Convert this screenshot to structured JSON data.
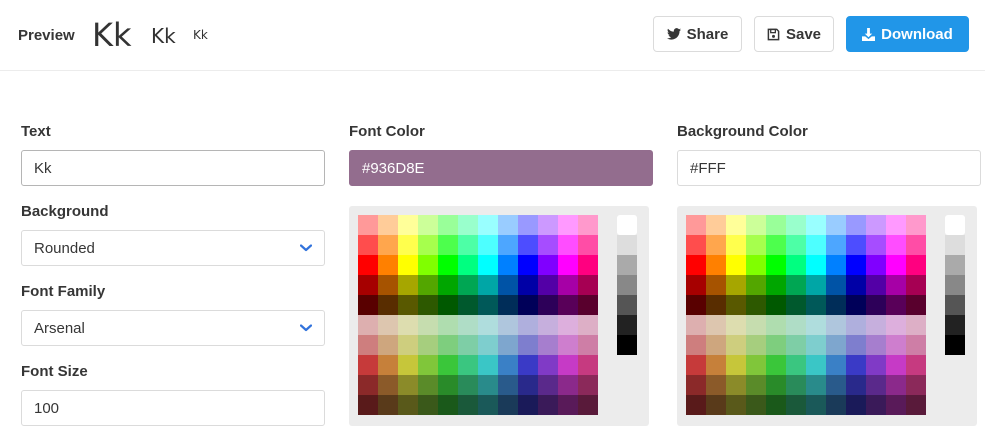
{
  "header": {
    "preview_label": "Preview",
    "preview_sample": "Kk",
    "share_label": "Share",
    "save_label": "Save",
    "download_label": "Download",
    "share_icon": "twitter-icon",
    "save_icon": "floppy-disk-icon",
    "download_icon": "download-icon"
  },
  "form": {
    "text_label": "Text",
    "text_value": "Kk",
    "background_label": "Background",
    "background_value": "Rounded",
    "font_family_label": "Font Family",
    "font_family_value": "Arsenal",
    "font_size_label": "Font Size",
    "font_size_value": "100",
    "font_color_label": "Font Color",
    "font_color_value": "#936D8E",
    "bg_color_label": "Background Color",
    "bg_color_value": "#FFF"
  },
  "colors": {
    "accent": "#2196e8",
    "font_color": "#936D8E",
    "chevron": "#3273dc",
    "palette_hues": [
      "#FF0000",
      "#FF8000",
      "#FFFF00",
      "#80FF00",
      "#00FF00",
      "#00FF80",
      "#00FFFF",
      "#0080FF",
      "#0000FF",
      "#8000FF",
      "#FF00FF",
      "#FF0080"
    ],
    "palette_grays": [
      "#FFFFFF",
      "#DDDDDD",
      "#AAAAAA",
      "#888888",
      "#555555",
      "#222222",
      "#000000"
    ]
  }
}
